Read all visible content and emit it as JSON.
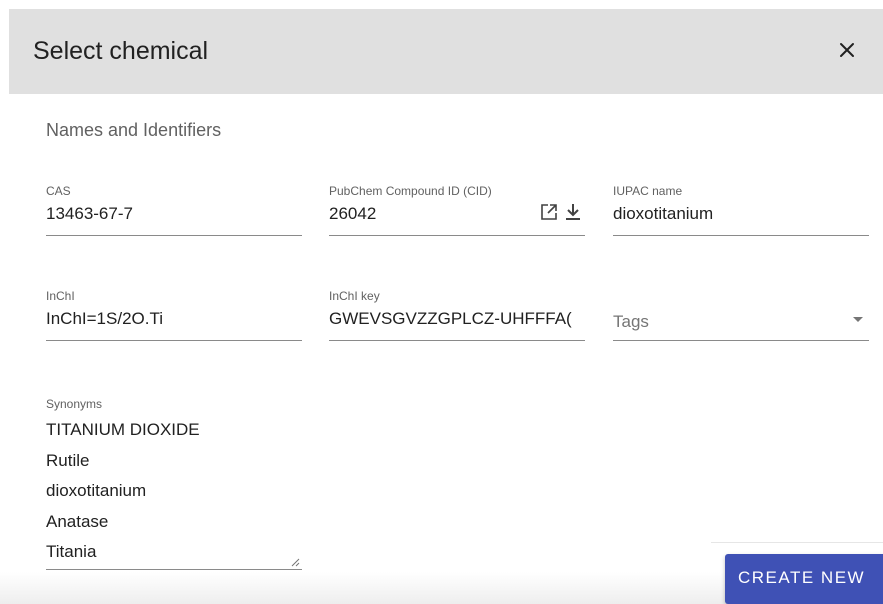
{
  "dialog": {
    "title": "Select chemical",
    "close_label": "×",
    "section_heading": "Names and Identifiers"
  },
  "fields": {
    "cas": {
      "label": "CAS",
      "value": "13463-67-7"
    },
    "pubchem_cid": {
      "label": "PubChem Compound ID (CID)",
      "value": "26042"
    },
    "iupac_name": {
      "label": "IUPAC name",
      "value": "dioxotitanium"
    },
    "inchi": {
      "label": "InChI",
      "value": "InChI=1S/2O.Ti"
    },
    "inchi_key": {
      "label": "InChI key",
      "value": "GWEVSGVZZGPLCZ-UHFFFA("
    },
    "tags": {
      "placeholder": "Tags"
    },
    "synonyms": {
      "label": "Synonyms",
      "items": [
        "TITANIUM DIOXIDE",
        "Rutile",
        "dioxotitanium",
        "Anatase",
        "Titania"
      ]
    }
  },
  "footer": {
    "create_button_label": "CREATE NEW"
  },
  "colors": {
    "header_bg": "#e0e0e0",
    "primary": "#3f51b5"
  },
  "icons": {
    "close": "close-icon",
    "open_external": "open-external-icon",
    "download": "download-icon",
    "dropdown": "dropdown-arrow-icon"
  }
}
